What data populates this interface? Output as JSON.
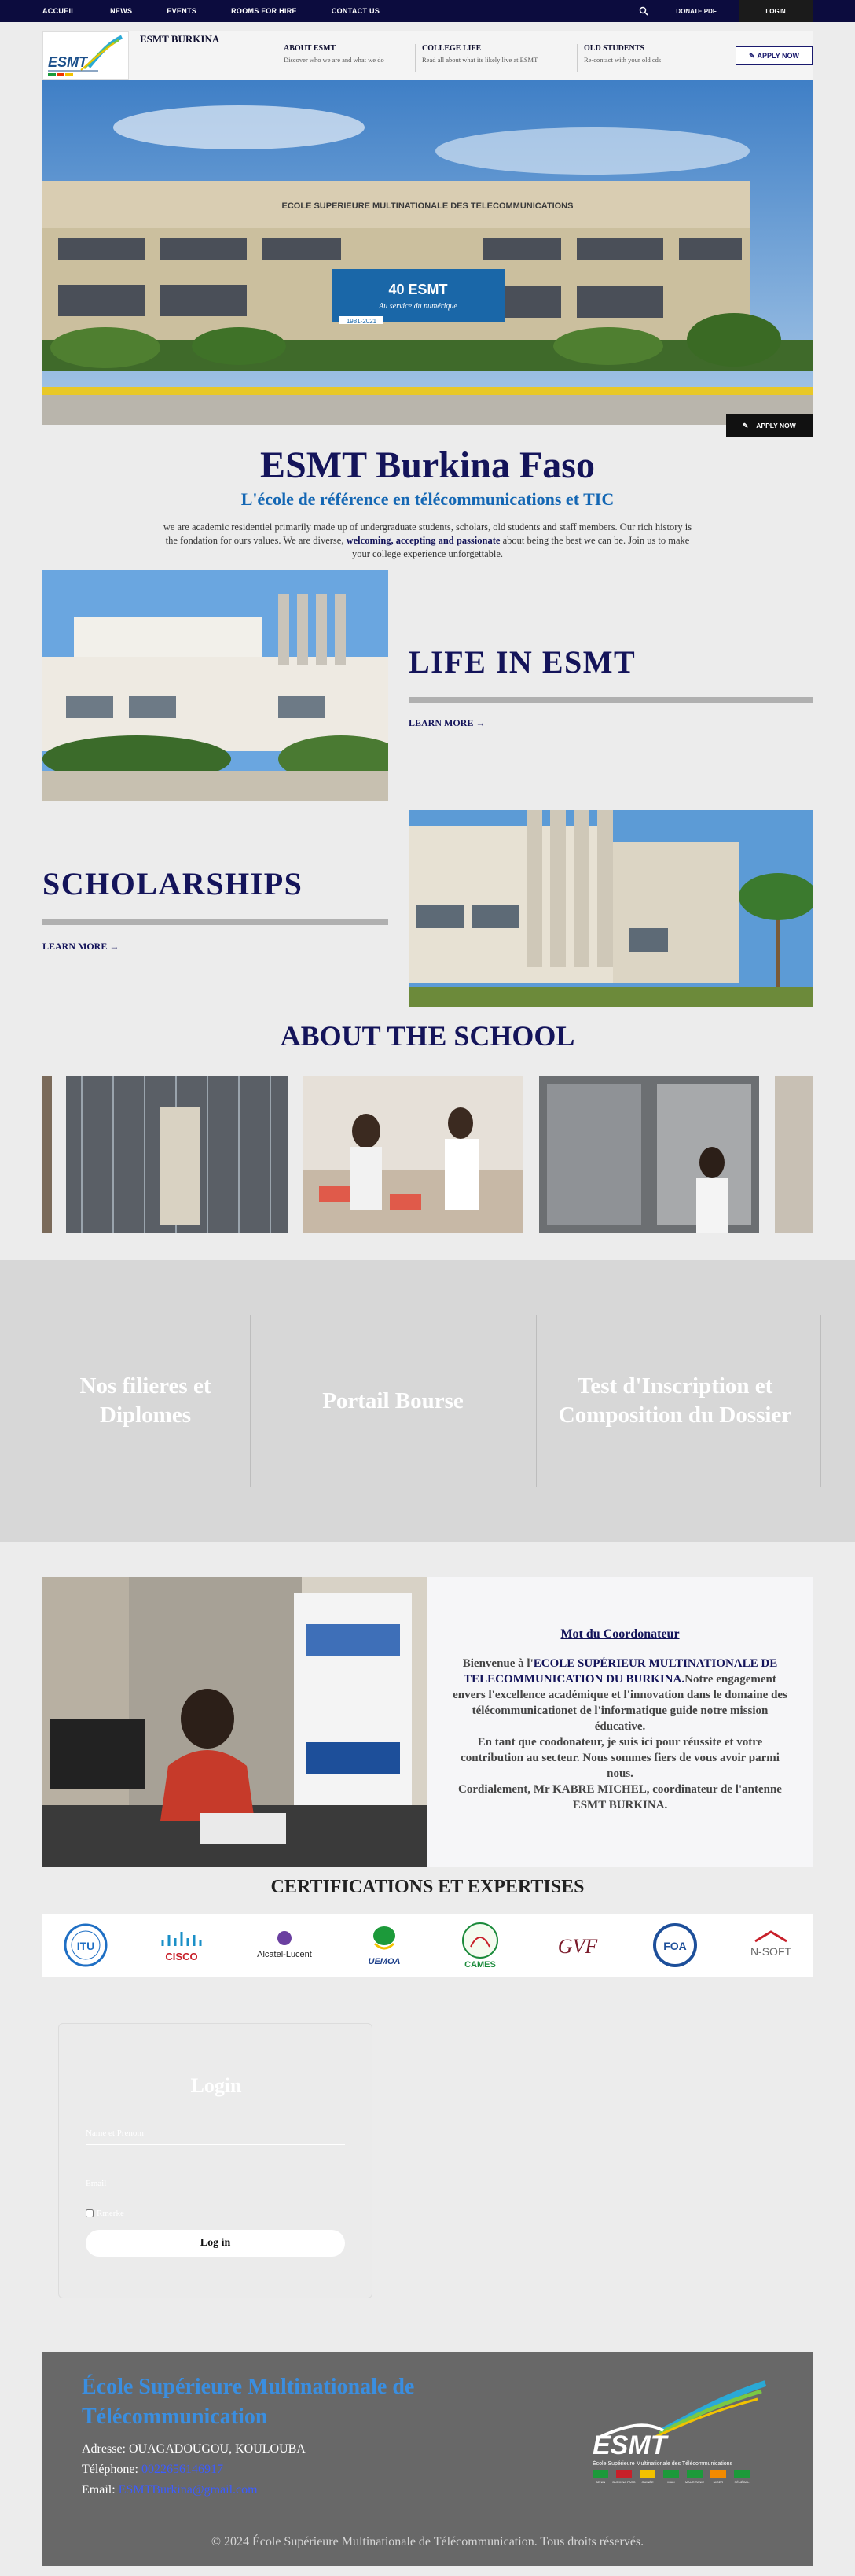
{
  "topbar": {
    "nav": [
      "ACCUEIL",
      "NEWS",
      "EVENTS",
      "ROOMS FOR HIRE",
      "CONTACT US"
    ],
    "search_icon": "search-icon",
    "donate_label": "DONATE PDF",
    "login_label": "LOGIN"
  },
  "header": {
    "site_name": "ESMT BURKINA",
    "logo_text": "ESMT",
    "links": [
      {
        "title": "ABOUT ESMT",
        "desc": "Discover who we are and what we do"
      },
      {
        "title": "COLLEGE LIFE",
        "desc": "Read all about what its likely live at ESMT"
      },
      {
        "title": "OLD STUDENTS",
        "desc": "Re-contact with your old cds"
      }
    ],
    "apply_label": "APPLY NOW"
  },
  "hero": {
    "building_sign": "ECOLE SUPERIEURE MULTINATIONALE DES TELECOMMUNICATIONS",
    "banner_text": "40 ESMT",
    "banner_sub": "Au service du numérique",
    "banner_years": "1981-2021",
    "apply_label": "APPLY NOW"
  },
  "intro": {
    "title": "ESMT Burkina Faso",
    "subtitle": "L'école de référence en télécommunications et TIC",
    "desc_1": "we are academic residentiel primarily made up of undergraduate students, scholars, old students and staff members. Our rich history is the fondation for ours values. We are diverse,",
    "desc_bold": "welcoming, accepting and passionate",
    "desc_2": "about being the best we can be. Join us to make your college experience unforgettable."
  },
  "life": {
    "title": "LIFE IN ESMT",
    "link": "LEARN MORE →"
  },
  "scholarships": {
    "title": "SCHOLARSHIPS",
    "link": "LEARN MORE →"
  },
  "about": {
    "title": "ABOUT THE SCHOOL"
  },
  "tiles": [
    "Nos filieres et Diplomes",
    "Portail Bourse",
    "Test d'Inscription et Composition du Dossier"
  ],
  "coordinator": {
    "title": "Mot du Coordonateur",
    "p1_a": "Bienvenue à l'",
    "p1_b": "ECOLE SUPÉRIEUR MULTINATIONALE DE TELECOMMUNICATION DU BURKINA.",
    "p1_c": "Notre engagement envers l'excellence académique et l'innovation dans le domaine des télécommunicationet de l'informatique guide notre mission éducative.",
    "p2": "En tant que coodonateur, je suis ici pour réussite et votre contribution au secteur. Nous sommes fiers de vous avoir parmi nous.",
    "p3": "Cordialement, Mr KABRE MICHEL, coordinateur de l'antenne ESMT BURKINA."
  },
  "certifications": {
    "title": "CERTIFICATIONS ET EXPERTISES",
    "logos": [
      "ITU",
      "CISCO",
      "Alcatel-Lucent",
      "UEMOA",
      "CAMES",
      "GVF",
      "FOA",
      "N-SOFT"
    ]
  },
  "login": {
    "title": "Login",
    "name_placeholder": "Name et Prenom",
    "email_placeholder": "Email",
    "remember_label": "Rmerke",
    "button": "Log in"
  },
  "footer": {
    "title": "École Supérieure Multinationale de Télécommunication",
    "address_label": "Adresse:",
    "address": "OUAGADOUGOU, KOULOUBA",
    "phone_label": "Téléphone:",
    "phone": "0022656146917",
    "email_label": "Email:",
    "email": "ESMTBurkina@gmail.com",
    "logo_text": "ESMT",
    "logo_sub": "École Supérieure Multinationale des Télécommunications",
    "countries": [
      "BENIN",
      "BURKINA FASO",
      "GUINÉE",
      "MALI",
      "MAURITANIE",
      "NIGER",
      "SÉNÉGAL"
    ],
    "copyright": "© 2024 École Supérieure Multinationale de Télécommunication. Tous droits réservés."
  },
  "colors": {
    "navy": "#0c0c3e",
    "title_blue": "#14145a",
    "link_blue": "#1467b4",
    "footer_grey": "#686868"
  }
}
